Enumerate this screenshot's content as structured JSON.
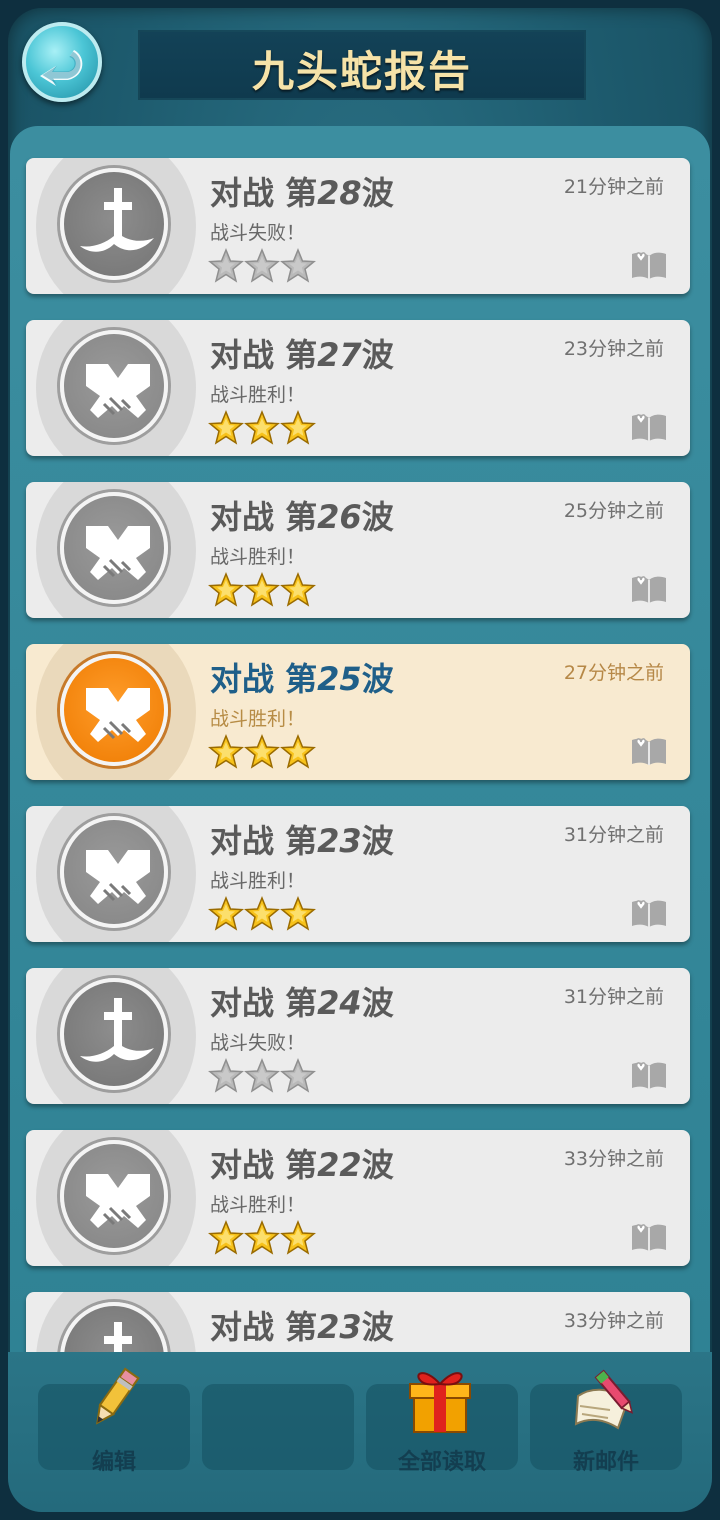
{
  "header": {
    "title": "九头蛇报告",
    "back_icon": "back-arrow-icon"
  },
  "reports": [
    {
      "title_prefix": "对战 第",
      "wave": "28",
      "title_suffix": "波",
      "result": "战斗失败！",
      "outcome": "defeat",
      "stars": 0,
      "time": "21分钟之前",
      "selected": false
    },
    {
      "title_prefix": "对战 第",
      "wave": "27",
      "title_suffix": "波",
      "result": "战斗胜利！",
      "outcome": "victory",
      "stars": 3,
      "time": "23分钟之前",
      "selected": false
    },
    {
      "title_prefix": "对战 第",
      "wave": "26",
      "title_suffix": "波",
      "result": "战斗胜利！",
      "outcome": "victory",
      "stars": 3,
      "time": "25分钟之前",
      "selected": false
    },
    {
      "title_prefix": "对战 第",
      "wave": "25",
      "title_suffix": "波",
      "result": "战斗胜利！",
      "outcome": "victory",
      "stars": 3,
      "time": "27分钟之前",
      "selected": true
    },
    {
      "title_prefix": "对战 第",
      "wave": "23",
      "title_suffix": "波",
      "result": "战斗胜利！",
      "outcome": "victory",
      "stars": 3,
      "time": "31分钟之前",
      "selected": false
    },
    {
      "title_prefix": "对战 第",
      "wave": "24",
      "title_suffix": "波",
      "result": "战斗失败！",
      "outcome": "defeat",
      "stars": 0,
      "time": "31分钟之前",
      "selected": false
    },
    {
      "title_prefix": "对战 第",
      "wave": "22",
      "title_suffix": "波",
      "result": "战斗胜利！",
      "outcome": "victory",
      "stars": 3,
      "time": "33分钟之前",
      "selected": false
    },
    {
      "title_prefix": "对战 第",
      "wave": "23",
      "title_suffix": "波",
      "result": "",
      "outcome": "defeat",
      "stars": 0,
      "time": "33分钟之前",
      "selected": false
    }
  ],
  "toolbar": {
    "edit_label": "编辑",
    "empty_label": "",
    "read_all_label": "全部读取",
    "new_mail_label": "新邮件"
  },
  "colors": {
    "accent_title": "#f6e3a8",
    "selected_bg": "#f8ead0",
    "selected_title": "#1f5f89",
    "medal_orange": "#ee7a00"
  }
}
